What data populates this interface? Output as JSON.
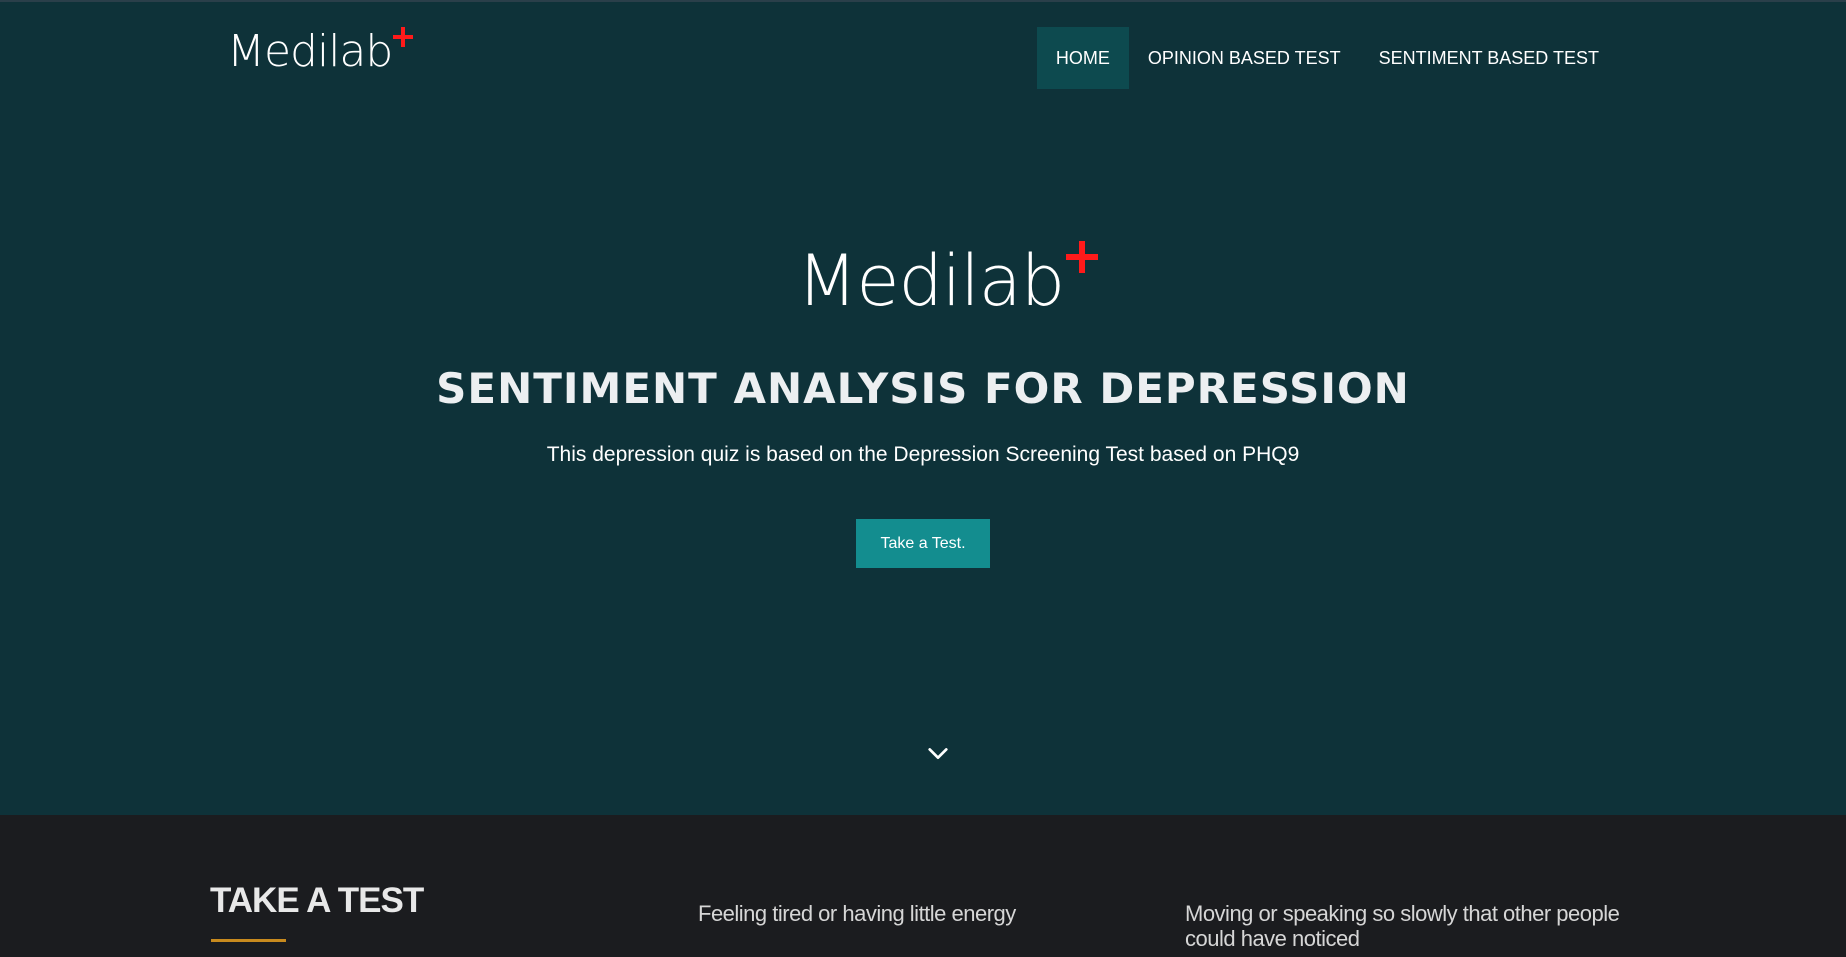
{
  "header": {
    "logo_text": "Medilab",
    "nav": [
      {
        "label": "HOME",
        "active": true
      },
      {
        "label": "OPINION BASED TEST",
        "active": false
      },
      {
        "label": "SENTIMENT BASED TEST",
        "active": false
      }
    ]
  },
  "hero": {
    "logo_text": "Medilab",
    "title": "SENTIMENT ANALYSIS FOR DEPRESSION",
    "subtitle": "This depression quiz is based on the Depression Screening Test based on PHQ9",
    "button_label": "Take a Test.",
    "scroll_icon": "chevron-down-icon"
  },
  "section": {
    "title": "TAKE A TEST",
    "questions": [
      "Feeling tired or having little energy",
      "Moving or speaking so slowly that other people could have noticed"
    ]
  },
  "colors": {
    "hero_background": "#0e3239",
    "nav_active": "#0d4a4f",
    "button": "#138d8f",
    "logo_plus": "#ff1a1a",
    "section_background": "#1b1c1f",
    "underline_accent": "#c88a1e"
  }
}
